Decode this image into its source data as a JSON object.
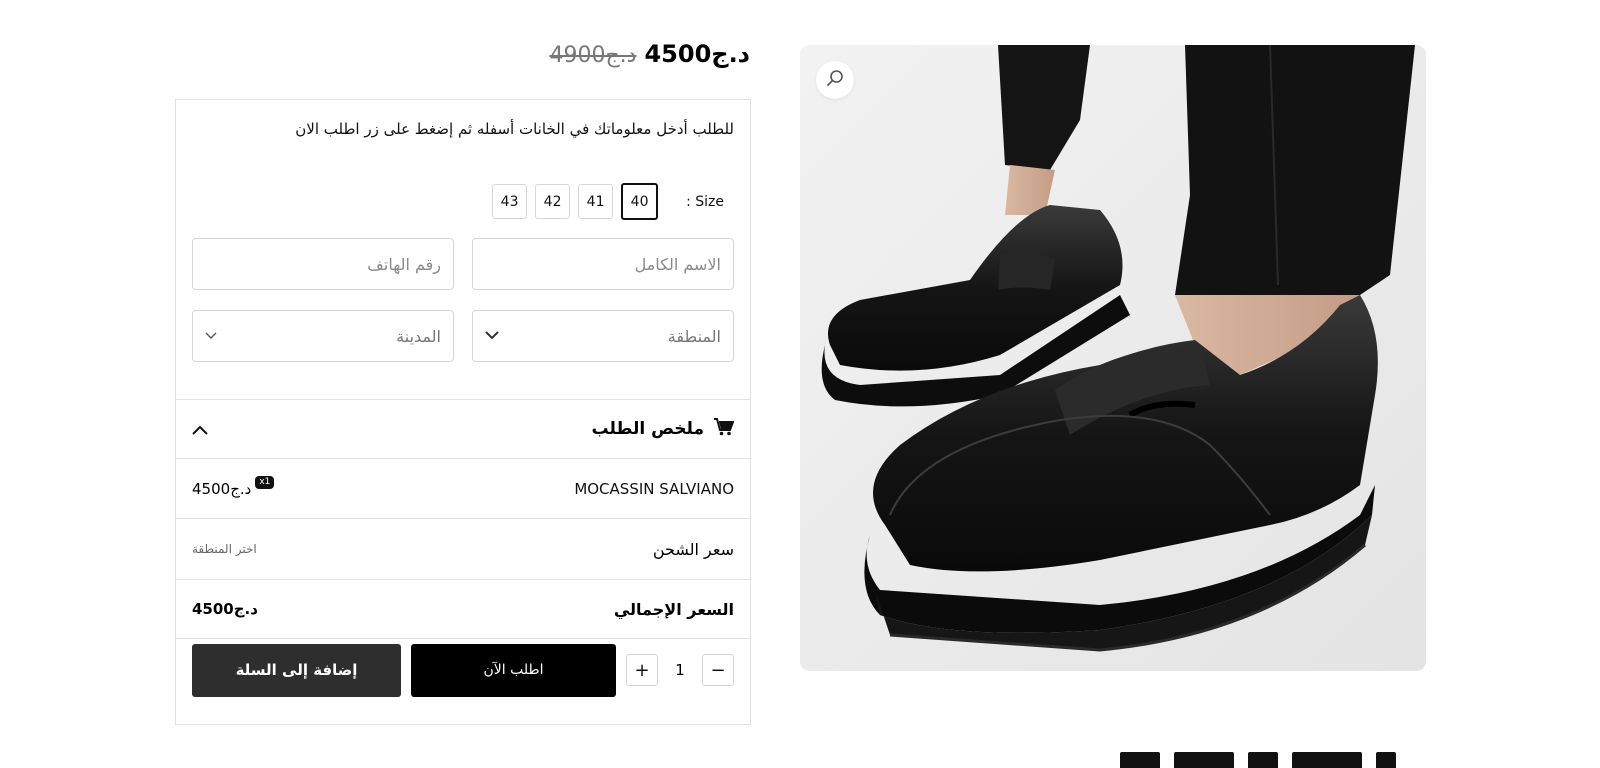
{
  "price": {
    "sale": "4500د.ج",
    "old": "4900د.ج"
  },
  "form": {
    "instructions": "للطلب أدخل معلوماتك في الخانات أسفله ثم إضغط على زر اطلب الان",
    "size_label": "Size :",
    "sizes": [
      "40",
      "41",
      "42",
      "43"
    ],
    "selected_size": "40",
    "name_placeholder": "الاسم الكامل",
    "phone_placeholder": "رقم الهاتف",
    "region_value": "المنطقة",
    "city_value": "المدينة"
  },
  "summary": {
    "title": "ملخص الطلب",
    "item_name": "MOCASSIN SALVIANO",
    "item_qty_badge": "x1",
    "item_price": "4500د.ج",
    "shipping_label": "سعر الشحن",
    "shipping_value": "اختر المنطقة",
    "total_label": "السعر الإجمالي",
    "total_value": "4500د.ج"
  },
  "actions": {
    "quantity": "1",
    "minus": "−",
    "plus": "+",
    "order_now": "اطلب الآن",
    "add_to_cart": "إضافة إلى السلة"
  },
  "icons": {
    "cart": "shopping-cart",
    "chevron_up": "chevron-up",
    "chevron_down": "chevron-down",
    "zoom": "search"
  },
  "colors": {
    "primary_button": "#000000",
    "secondary_button": "#2e2e2e",
    "border": "#e2e2e2"
  }
}
